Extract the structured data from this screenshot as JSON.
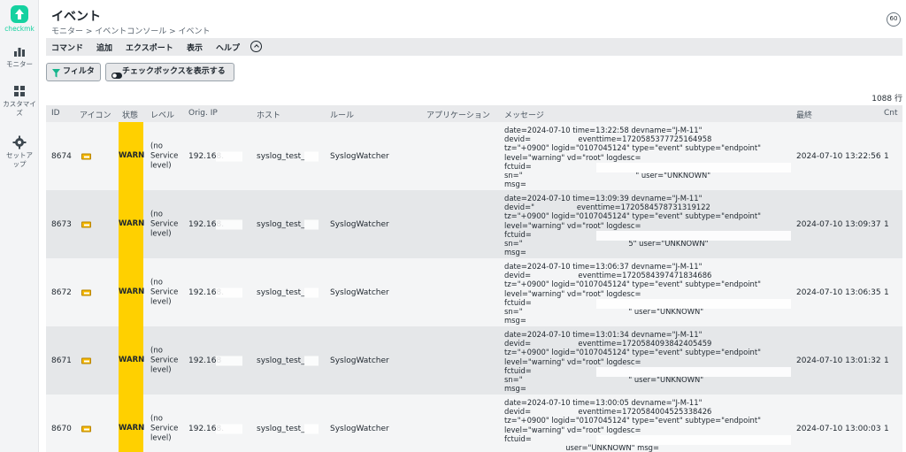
{
  "app": {
    "logo_text": "checkmk"
  },
  "sidebar": {
    "items": [
      {
        "label": "モニター",
        "icon": "bar-chart-icon"
      },
      {
        "label": "カスタマイズ",
        "icon": "grid-icon"
      },
      {
        "label": "セットアップ",
        "icon": "gear-icon"
      }
    ]
  },
  "header": {
    "title": "イベント",
    "breadcrumb": "モニター > イベントコンソール > イベント",
    "refresh_value": "60"
  },
  "menubar": {
    "items": [
      "コマンド",
      "追加",
      "エクスポート",
      "表示",
      "ヘルプ"
    ]
  },
  "toolbar": {
    "filter_label": "フィルタ",
    "checkbox_label": "チェックボックスを表示する"
  },
  "table": {
    "row_count": "1088 行",
    "columns": [
      "ID",
      "アイコン",
      "状態",
      "レベル",
      "Orig. IP",
      "ホスト",
      "ルール",
      "アプリケーション",
      "メッセージ",
      "最終",
      "Cnt"
    ],
    "rows": [
      {
        "id": "8674",
        "state": "WARN",
        "level": "(no Service level)",
        "ip": "192.168.",
        "host": "syslog_test_",
        "rule": "SyslogWatcher",
        "message": "date=2024-07-10 time=13:22:58 devname=\"J-M-11\"\ndevid=                    eventtime=1720585377725164958\ntz=\"+0900\" logid=\"0107045124\" type=\"event\" subtype=\"endpoint\"\nlevel=\"warning\" vd=\"root\" logdesc=\nfctuid=\nsn=\"                                                \" user=\"UNKNOWN\"\nmsg=",
        "last": "2024-07-10 13:22:56",
        "count": "1"
      },
      {
        "id": "8673",
        "state": "WARN",
        "level": "(no Service level)",
        "ip": "192.168.",
        "host": "syslog_test_",
        "rule": "SyslogWatcher",
        "message": "date=2024-07-10 time=13:09:39 devname=\"J-M-11\"\ndevid=\"                  eventtime=1720584578731319122\ntz=\"+0900\" logid=\"0107045124\" type=\"event\" subtype=\"endpoint\"\nlevel=\"warning\" vd=\"root\" logdesc=\nfctuid=\nsn=\"                                             5\" user=\"UNKNOWN\"\nmsg=",
        "last": "2024-07-10 13:09:37",
        "count": "1"
      },
      {
        "id": "8672",
        "state": "WARN",
        "level": "(no Service level)",
        "ip": "192.168.",
        "host": "syslog_test_",
        "rule": "SyslogWatcher",
        "message": "date=2024-07-10 time=13:06:37 devname=\"J-M-11\"\ndevid=                    eventtime=1720584397471834686\ntz=\"+0900\" logid=\"0107045124\" type=\"event\" subtype=\"endpoint\"\nlevel=\"warning\" vd=\"root\" logdesc=\nfctuid=\nsn=\"                                             \" user=\"UNKNOWN\"\nmsg=",
        "last": "2024-07-10 13:06:35",
        "count": "1"
      },
      {
        "id": "8671",
        "state": "WARN",
        "level": "(no Service level)",
        "ip": "192.168",
        "host": "syslog_test_",
        "rule": "SyslogWatcher",
        "message": "date=2024-07-10 time=13:01:34 devname=\"J-M-11\"\ndevid=                    eventtime=1720584093842405459\ntz=\"+0900\" logid=\"0107045124\" type=\"event\" subtype=\"endpoint\"\nlevel=\"warning\" vd=\"root\" logdesc=\nfctuid=\nsn=\"                                             \" user=\"UNKNOWN\"\nmsg=",
        "last": "2024-07-10 13:01:32",
        "count": "1"
      },
      {
        "id": "8670",
        "state": "WARN",
        "level": "(no Service level)",
        "ip": "192.168.",
        "host": "syslog_test_",
        "rule": "SyslogWatcher",
        "message": "date=2024-07-10 time=13:00:05 devname=\"J-M-11\"\ndevid=                    eventtime=1720584004525338426\ntz=\"+0900\" logid=\"0107045124\" type=\"event\" subtype=\"endpoint\"\nlevel=\"warning\" vd=\"root\" logdesc=\nfctuid=\n                          user=\"UNKNOWN\" msg=",
        "last": "2024-07-10 13:00:03",
        "count": "1"
      }
    ]
  },
  "colors": {
    "warn": "#ffd000",
    "brand": "#15d1a0"
  }
}
